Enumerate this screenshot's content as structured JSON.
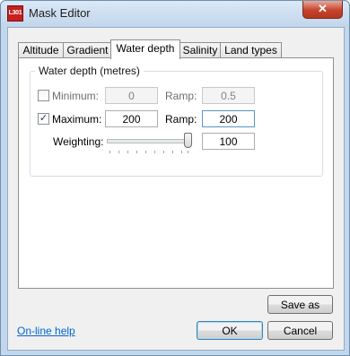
{
  "window": {
    "title": "Mask Editor",
    "app_icon_text": "L301",
    "close_glyph": "✕"
  },
  "tabs": [
    {
      "label": "Altitude"
    },
    {
      "label": "Gradient"
    },
    {
      "label": "Water depth",
      "active": true
    },
    {
      "label": "Salinity"
    },
    {
      "label": "Land types"
    }
  ],
  "group": {
    "title": "Water depth (metres)",
    "minimum": {
      "label": "Minimum:",
      "checked": false,
      "value": "0",
      "ramp_label": "Ramp:",
      "ramp_value": "0.5"
    },
    "maximum": {
      "label": "Maximum:",
      "checked": true,
      "value": "200",
      "ramp_label": "Ramp:",
      "ramp_value": "200"
    },
    "weighting": {
      "label": "Weighting:",
      "value": "100",
      "slider_level": 1.0
    }
  },
  "buttons": {
    "save_as": "Save as",
    "ok": "OK",
    "cancel": "Cancel"
  },
  "help_link": "On-line help",
  "check_glyph": "✓"
}
